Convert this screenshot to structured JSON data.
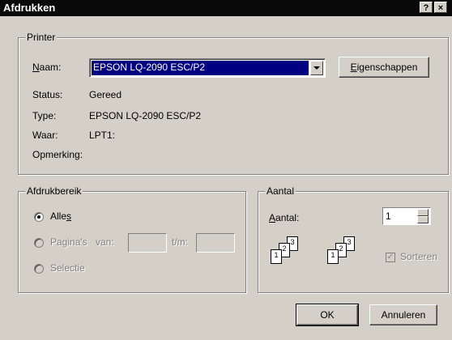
{
  "window": {
    "title": "Afdrukken",
    "help_btn": "?",
    "close_btn": "×"
  },
  "printer": {
    "group_label": "Printer",
    "name_label": "Naam:",
    "name_value": "EPSON LQ-2090 ESC/P2",
    "properties_btn": "Eigenschappen",
    "status_label": "Status:",
    "status_value": "Gereed",
    "type_label": "Type:",
    "type_value": "EPSON LQ-2090 ESC/P2",
    "where_label": "Waar:",
    "where_value": "LPT1:",
    "comment_label": "Opmerking:"
  },
  "range": {
    "group_label": "Afdrukbereik",
    "all_label": "Alles",
    "pages_label": "Pagina's",
    "from_label": "van:",
    "to_label": "t/m:",
    "selection_label": "Selectie",
    "selected": "all"
  },
  "copies": {
    "group_label": "Aantal",
    "count_label": "Aantal:",
    "count_value": "1",
    "collate_label": "Sorteren",
    "collate_checked": true
  },
  "buttons": {
    "ok": "OK",
    "cancel": "Annuleren"
  },
  "collate_icon": {
    "pages": [
      "1",
      "2",
      "3"
    ]
  }
}
